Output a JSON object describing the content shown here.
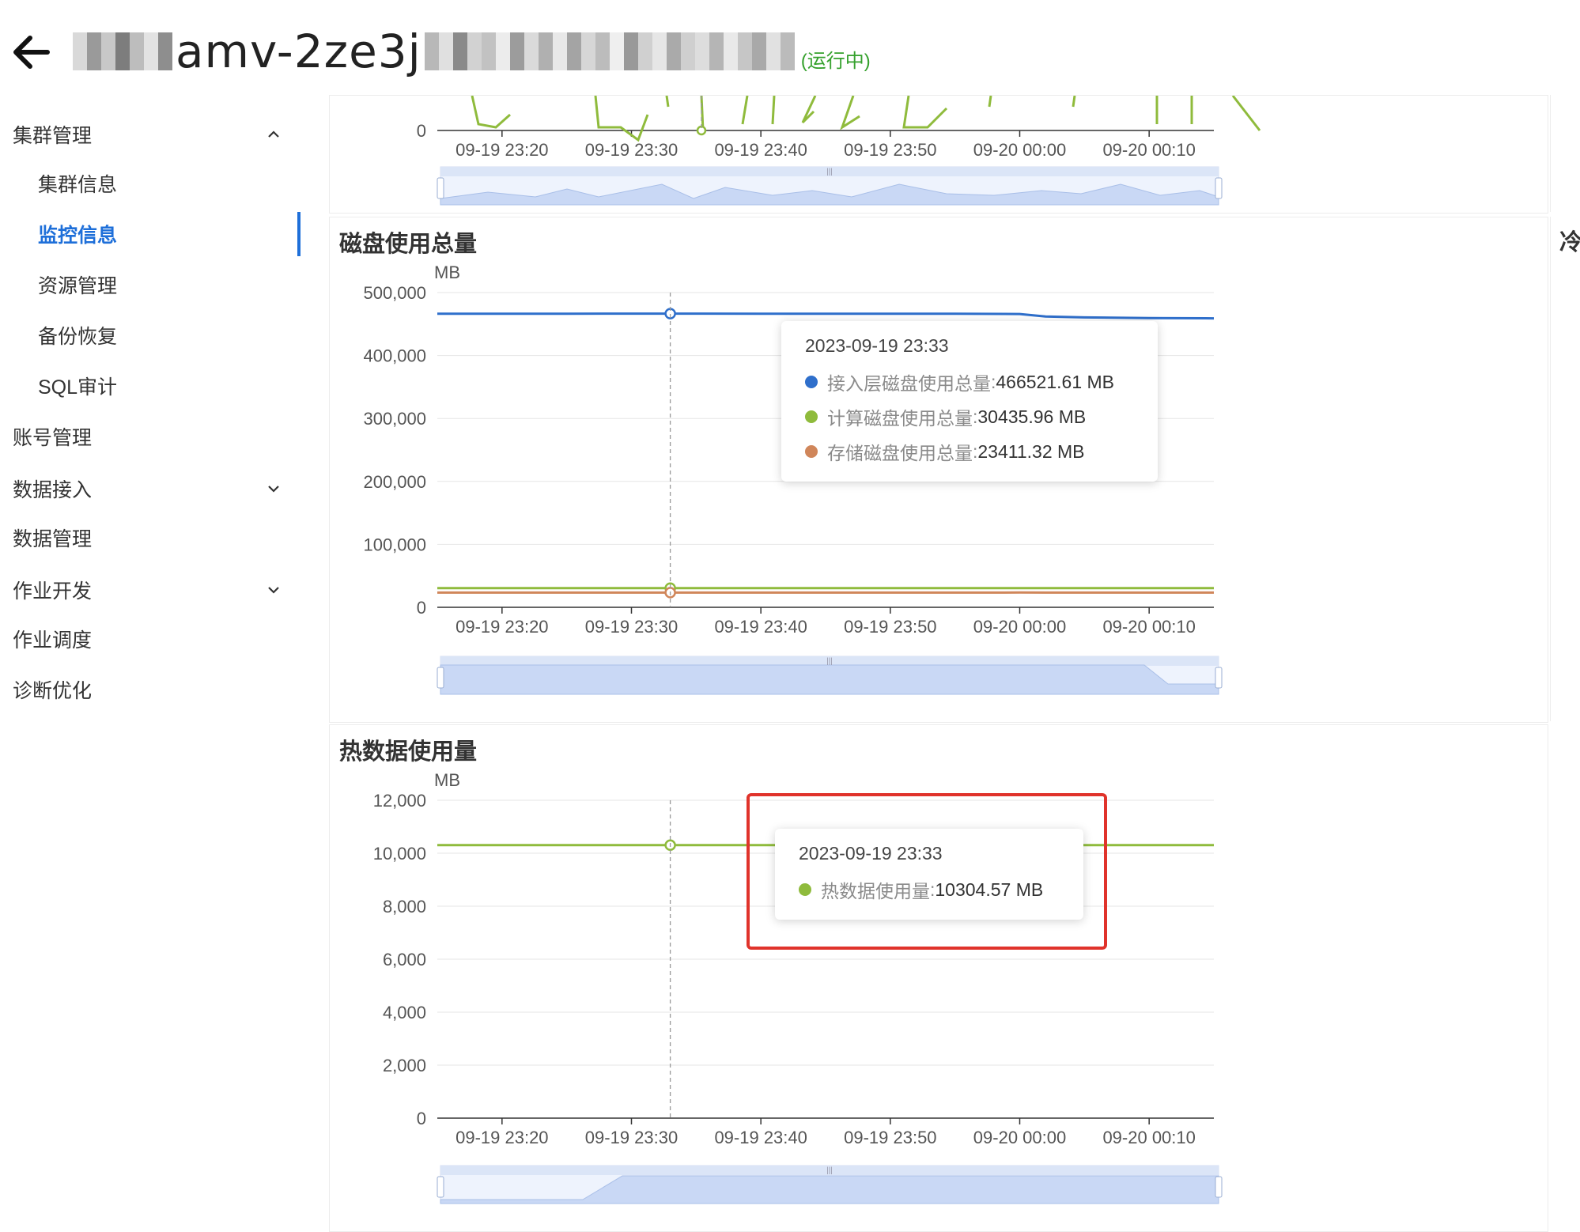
{
  "header": {
    "title_visible": "amv-2ze3j",
    "status": "(运行中)"
  },
  "sidebar": {
    "groups": [
      {
        "label": "集群管理",
        "expanded": true,
        "chevron": "chevron-up-icon"
      },
      {
        "label": "账号管理"
      },
      {
        "label": "数据接入",
        "expanded": false,
        "chevron": "chevron-down-icon"
      },
      {
        "label": "数据管理"
      },
      {
        "label": "作业开发",
        "expanded": false,
        "chevron": "chevron-down-icon"
      },
      {
        "label": "作业调度"
      },
      {
        "label": "诊断优化"
      }
    ],
    "subitems": [
      {
        "label": "集群信息"
      },
      {
        "label": "监控信息",
        "active": true
      },
      {
        "label": "资源管理"
      },
      {
        "label": "备份恢复"
      },
      {
        "label": "SQL审计"
      }
    ]
  },
  "colors": {
    "blue": "#2f6fcb",
    "green": "#8fbb3c",
    "orange": "#d0865a",
    "accent": "#1e6fd9",
    "status": "#35a12d",
    "highlight": "#e0332b"
  },
  "cold_label": "冷",
  "chart_data": [
    {
      "type": "line",
      "title": "",
      "partial": true,
      "x_ticks": [
        "09-19 23:20",
        "09-19 23:30",
        "09-19 23:40",
        "09-19 23:50",
        "09-20 00:00",
        "09-20 00:10"
      ],
      "y_ticks": [
        "0"
      ]
    },
    {
      "type": "line",
      "title": "磁盘使用总量",
      "ylabel": "MB",
      "ylim": [
        0,
        500000
      ],
      "y_ticks": [
        "500,000",
        "400,000",
        "300,000",
        "200,000",
        "100,000",
        "0"
      ],
      "x_ticks": [
        "09-19 23:20",
        "09-19 23:30",
        "09-19 23:40",
        "09-19 23:50",
        "09-20 00:00",
        "09-20 00:10"
      ],
      "x": [
        "09-19 23:15",
        "09-19 23:20",
        "09-19 23:25",
        "09-19 23:30",
        "09-19 23:33",
        "09-19 23:40",
        "09-19 23:45",
        "09-19 23:50",
        "09-19 23:55",
        "09-20 00:00",
        "09-20 00:02",
        "09-20 00:05",
        "09-20 00:10",
        "09-20 00:15"
      ],
      "series": [
        {
          "name": "接入层磁盘使用总量",
          "color": "#2f6fcb",
          "values": [
            466500,
            466500,
            466500,
            466521.61,
            466521.61,
            466500,
            466500,
            466500,
            466500,
            466000,
            462000,
            460500,
            459500,
            459000
          ]
        },
        {
          "name": "计算磁盘使用总量",
          "color": "#8fbb3c",
          "values": [
            30400,
            30400,
            30400,
            30435.96,
            30435.96,
            30400,
            30400,
            30400,
            30400,
            30400,
            30400,
            30400,
            30400,
            30400
          ]
        },
        {
          "name": "存储磁盘使用总量",
          "color": "#d0865a",
          "values": [
            23400,
            23400,
            23400,
            23411.32,
            23411.32,
            23400,
            23400,
            23400,
            23400,
            23500,
            23400,
            23400,
            23400,
            23400
          ]
        }
      ],
      "tooltip": {
        "time": "2023-09-19 23:33",
        "rows": [
          {
            "name": "接入层磁盘使用总量",
            "value": "466521.61 MB"
          },
          {
            "name": "计算磁盘使用总量",
            "value": "30435.96 MB"
          },
          {
            "name": "存储磁盘使用总量",
            "value": "23411.32 MB"
          }
        ]
      }
    },
    {
      "type": "line",
      "title": "热数据使用量",
      "ylabel": "MB",
      "ylim": [
        0,
        12000
      ],
      "y_ticks": [
        "12,000",
        "10,000",
        "8,000",
        "6,000",
        "4,000",
        "2,000",
        "0"
      ],
      "x_ticks": [
        "09-19 23:20",
        "09-19 23:30",
        "09-19 23:40",
        "09-19 23:50",
        "09-20 00:00",
        "09-20 00:10"
      ],
      "x": [
        "09-19 23:15",
        "09-19 23:33",
        "09-20 00:15"
      ],
      "series": [
        {
          "name": "热数据使用量",
          "color": "#8fbb3c",
          "values": [
            10304.57,
            10304.57,
            10304.57
          ]
        }
      ],
      "tooltip": {
        "time": "2023-09-19 23:33",
        "rows": [
          {
            "name": "热数据使用量",
            "value": "10304.57 MB"
          }
        ]
      }
    }
  ]
}
